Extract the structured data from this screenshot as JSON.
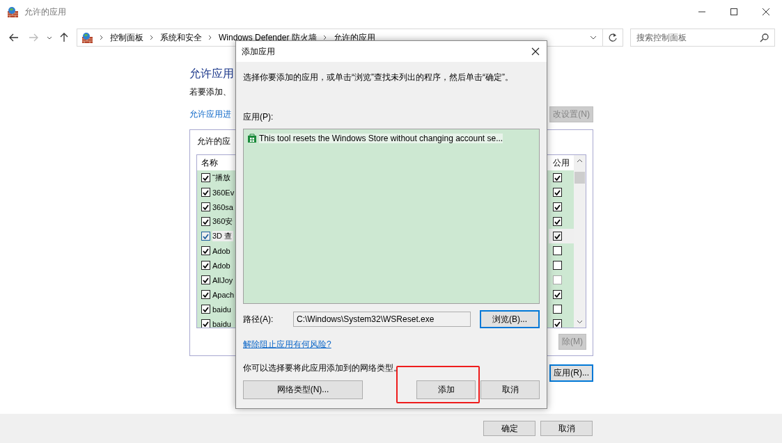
{
  "window": {
    "title": "允许的应用"
  },
  "nav": {
    "breadcrumb": [
      "控制面板",
      "系统和安全",
      "Windows Defender 防火墙",
      "允许的应用"
    ],
    "search": {
      "placeholder": "搜索控制面板"
    }
  },
  "page": {
    "heading": "允许应用",
    "description": "若要添加、",
    "settings_link": "允许应用进",
    "change_settings_button": {
      "label": "改设置(N)",
      "disabled": true
    },
    "group": {
      "label": "允许的应",
      "columns": [
        "名称",
        "公用"
      ],
      "rows": [
        {
          "name": "“播放",
          "checked": true,
          "public": true,
          "public_disabled": false,
          "selected": false
        },
        {
          "name": "360Ev",
          "checked": true,
          "public": true,
          "public_disabled": false,
          "selected": false
        },
        {
          "name": "360sa",
          "checked": true,
          "public": true,
          "public_disabled": false,
          "selected": false
        },
        {
          "name": "360安",
          "checked": true,
          "public": true,
          "public_disabled": false,
          "selected": false
        },
        {
          "name": "3D 查",
          "checked": true,
          "public": true,
          "public_disabled": false,
          "selected": true
        },
        {
          "name": "Adob",
          "checked": true,
          "public": false,
          "public_disabled": false,
          "selected": false
        },
        {
          "name": "Adob",
          "checked": true,
          "public": false,
          "public_disabled": false,
          "selected": false
        },
        {
          "name": "AllJoy",
          "checked": true,
          "public": false,
          "public_disabled": true,
          "selected": false
        },
        {
          "name": "Apach",
          "checked": true,
          "public": true,
          "public_disabled": false,
          "selected": false
        },
        {
          "name": "baidu",
          "checked": true,
          "public": false,
          "public_disabled": false,
          "selected": false
        },
        {
          "name": "baidu",
          "checked": true,
          "public": true,
          "public_disabled": false,
          "selected": false
        }
      ],
      "remove_button": {
        "label": "除(M)",
        "disabled": true
      }
    },
    "allow_other_button": {
      "label": "应用(R)...",
      "focused": true
    },
    "buttons": [
      "确定",
      "取消"
    ]
  },
  "dialog": {
    "title": "添加应用",
    "instruction": "选择你要添加的应用，或单击“浏览”查找未列出的程序，然后单击“确定”。",
    "apps_label": "应用(P):",
    "apps": [
      {
        "name": "This tool resets the Windows Store without changing account se...",
        "selected": true
      }
    ],
    "path_label": "路径(A):",
    "path_value": "C:\\Windows\\System32\\WSReset.exe",
    "browse_button": {
      "label": "浏览(B)...",
      "focused": true
    },
    "risk_link": "解除阻止应用有何风险?",
    "network_text": "你可以选择要将此应用添加到的网络类型。",
    "buttons": [
      {
        "label": "网络类型(N)...",
        "highlighted": false
      },
      {
        "label": "添加",
        "highlighted": true
      },
      {
        "label": "取消",
        "highlighted": false
      }
    ]
  }
}
